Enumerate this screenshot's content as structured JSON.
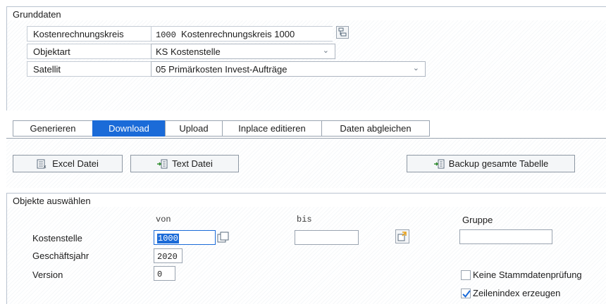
{
  "grunddaten": {
    "title": "Grunddaten",
    "rows": {
      "krkreis": {
        "label": "Kostenrechnungskreis",
        "code": "1000",
        "text": "Kostenrechnungskreis 1000"
      },
      "objektart": {
        "label": "Objektart",
        "value": "KS Kostenstelle"
      },
      "satellit": {
        "label": "Satellit",
        "value": "05 Primärkosten Invest-Aufträge"
      }
    }
  },
  "tabs": [
    "Generieren",
    "Download",
    "Upload",
    "Inplace editieren",
    "Daten abgleichen"
  ],
  "active_tab": "Download",
  "buttons": {
    "excel": "Excel Datei",
    "text": "Text Datei",
    "backup": "Backup gesamte Tabelle"
  },
  "objekte": {
    "title": "Objekte auswählen",
    "col_von": "von",
    "col_bis": "bis",
    "col_gruppe": "Gruppe",
    "kostenstelle": {
      "label": "Kostenstelle",
      "von": "1000",
      "bis": "",
      "gruppe": ""
    },
    "geschaeftsjahr": {
      "label": "Geschäftsjahr",
      "value": "2020"
    },
    "version": {
      "label": "Version",
      "value": "0"
    },
    "checkboxes": {
      "keine_stammdaten": {
        "label": "Keine Stammdatenprüfung",
        "checked": false
      },
      "zeilenindex": {
        "label": "Zeilenindex erzeugen",
        "checked": true
      }
    }
  },
  "colors": {
    "accent": "#1b6bd8",
    "border": "#9aa4b0"
  }
}
